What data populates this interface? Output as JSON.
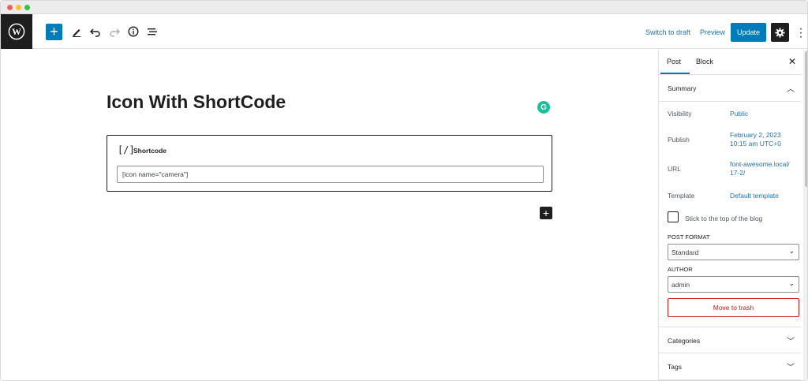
{
  "toolbar": {
    "add_label": "+",
    "switch_to_draft": "Switch to draft",
    "preview": "Preview",
    "update": "Update"
  },
  "editor": {
    "post_title": "Icon With ShortCode",
    "grammarly_letter": "G",
    "shortcode_block": {
      "icon_text": "[/]",
      "label": "Shortcode",
      "value": "[icon name=\"camera\"]"
    },
    "inserter_label": "+"
  },
  "sidebar": {
    "tabs": [
      {
        "label": "Post",
        "active": true
      },
      {
        "label": "Block",
        "active": false
      }
    ],
    "close_label": "✕",
    "summary": {
      "heading": "Summary",
      "rows": [
        {
          "label": "Visibility",
          "value": "Public"
        },
        {
          "label": "Publish",
          "value": "February 2, 2023 10:15 am UTC+0"
        },
        {
          "label": "URL",
          "value": "font-awesome.local/17-2/"
        },
        {
          "label": "Template",
          "value": "Default template"
        }
      ],
      "sticky_label": "Stick to the top of the blog",
      "post_format_label": "POST FORMAT",
      "post_format_value": "Standard",
      "author_label": "AUTHOR",
      "author_value": "admin",
      "trash_label": "Move to trash"
    },
    "categories_heading": "Categories",
    "tags_heading": "Tags"
  },
  "colors": {
    "accent": "#007cba",
    "link": "#2271b1",
    "danger": "#cc1818",
    "dark": "#1e1e1e",
    "grammarly": "#15c39a"
  }
}
